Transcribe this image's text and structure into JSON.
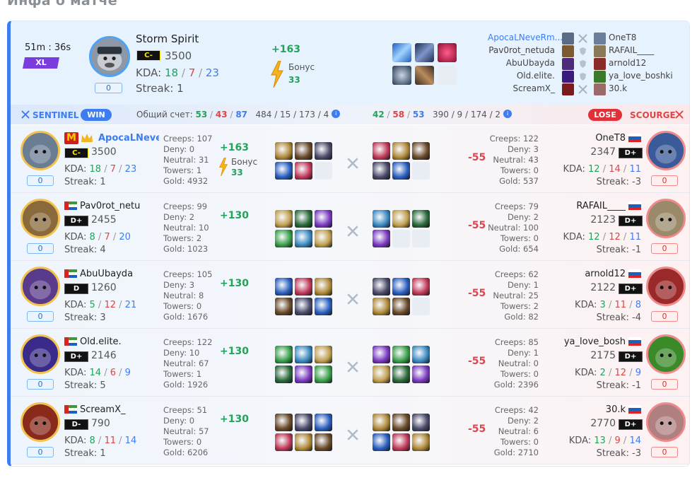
{
  "page_title": "Инфа о матче",
  "summary": {
    "duration": "51m : 36s",
    "mode_badge": "XL",
    "hero_name": "Storm Spirit",
    "rank": "C-",
    "mmr": "3500",
    "kda_label": "KDA:",
    "kills": "18",
    "deaths": "7",
    "assists": "23",
    "streak": "Streak: 1",
    "zero": "0",
    "gain": "+163",
    "bonus_label": "Бонус",
    "bonus_value": "33",
    "sentinel_players": [
      "ApocaLNeveRm...",
      "Pav0rot_netuda",
      "AbuUbayda",
      "Old.elite.",
      "ScreamX_"
    ],
    "scourge_players": [
      "OneT8",
      "RAFAIL____",
      "arnold12",
      "ya_love_boshki",
      "30.k"
    ]
  },
  "teambar": {
    "sentinel": "SENTINEL",
    "win": "WIN",
    "score_label": "Общий счет:",
    "s_k": "53",
    "s_d": "43",
    "s_a": "87",
    "s_rest": "484 / 15 / 173 / 4",
    "c_k": "42",
    "c_d": "58",
    "c_a": "53",
    "c_rest": "390 / 9 / 174 / 2",
    "lose": "LOSE",
    "scourge": "SCOURGE"
  },
  "rows": [
    {
      "left": {
        "name": "ApocaLNeveR",
        "rank": "C-",
        "mmr": "3500",
        "k": "18",
        "d": "7",
        "a": "23",
        "streak": "Streak: 1",
        "creeps": "Creeps: 107",
        "deny": "Deny: 0",
        "neutral": "Neutral: 31",
        "towers": "Towers: 1",
        "gold": "Gold: 4932"
      },
      "gain": "+163",
      "bonus_label": "Бонус",
      "bonus": "33",
      "loss": "-55",
      "right": {
        "name": "OneT8",
        "rank": "D+",
        "mmr": "2347",
        "k": "12",
        "d": "14",
        "a": "11",
        "streak": "Streak: -3",
        "creeps": "Creeps: 122",
        "deny": "Deny: 3",
        "neutral": "Neutral: 43",
        "towers": "Towers: 0",
        "gold": "Gold: 537"
      }
    },
    {
      "left": {
        "name": "Pav0rot_netu",
        "rank": "D+",
        "mmr": "2455",
        "k": "8",
        "d": "7",
        "a": "20",
        "streak": "Streak: 4",
        "creeps": "Creeps: 99",
        "deny": "Deny: 2",
        "neutral": "Neutral: 10",
        "towers": "Towers: 2",
        "gold": "Gold: 1023"
      },
      "gain": "+130",
      "loss": "-55",
      "right": {
        "name": "RAFAIL____",
        "rank": "D+",
        "mmr": "2123",
        "k": "12",
        "d": "12",
        "a": "11",
        "streak": "Streak: -1",
        "creeps": "Creeps: 79",
        "deny": "Deny: 2",
        "neutral": "Neutral: 100",
        "towers": "Towers: 0",
        "gold": "Gold: 654"
      }
    },
    {
      "left": {
        "name": "AbuUbayda",
        "rank": "D",
        "mmr": "1260",
        "k": "5",
        "d": "12",
        "a": "21",
        "streak": "Streak: 3",
        "creeps": "Creeps: 105",
        "deny": "Deny: 3",
        "neutral": "Neutral: 8",
        "towers": "Towers: 0",
        "gold": "Gold: 1676"
      },
      "gain": "+130",
      "loss": "-55",
      "right": {
        "name": "arnold12",
        "rank": "D+",
        "mmr": "2122",
        "k": "3",
        "d": "11",
        "a": "8",
        "streak": "Streak: -4",
        "creeps": "Creeps: 62",
        "deny": "Deny: 1",
        "neutral": "Neutral: 25",
        "towers": "Towers: 2",
        "gold": "Gold: 82"
      }
    },
    {
      "left": {
        "name": "Old.elite.",
        "rank": "D+",
        "mmr": "2146",
        "k": "14",
        "d": "6",
        "a": "9",
        "streak": "Streak: 5",
        "creeps": "Creeps: 122",
        "deny": "Deny: 10",
        "neutral": "Neutral: 67",
        "towers": "Towers: 1",
        "gold": "Gold: 1926"
      },
      "gain": "+130",
      "loss": "-55",
      "right": {
        "name": "ya_love_bosh",
        "rank": "D+",
        "mmr": "2175",
        "k": "2",
        "d": "12",
        "a": "9",
        "streak": "Streak: -1",
        "creeps": "Creeps: 85",
        "deny": "Deny: 1",
        "neutral": "Neutral: 0",
        "towers": "Towers: 0",
        "gold": "Gold: 2396"
      }
    },
    {
      "left": {
        "name": "ScreamX_",
        "rank": "D-",
        "mmr": "790",
        "k": "8",
        "d": "11",
        "a": "14",
        "streak": "Streak: 1",
        "creeps": "Creeps: 51",
        "deny": "Deny: 0",
        "neutral": "Neutral: 57",
        "towers": "Towers: 0",
        "gold": "Gold: 6206"
      },
      "gain": "+130",
      "loss": "-55",
      "right": {
        "name": "30.k",
        "rank": "D+",
        "mmr": "2770",
        "k": "13",
        "d": "9",
        "a": "14",
        "streak": "Streak: -3",
        "creeps": "Creeps: 42",
        "deny": "Deny: 2",
        "neutral": "Neutral: 6",
        "towers": "Towers: 0",
        "gold": "Gold: 2710"
      }
    }
  ],
  "kda_label": "KDA:",
  "zero": "0",
  "colors": {
    "accent": "#3d7df1",
    "win": "#22a35a",
    "lose": "#e04444",
    "xl": "#7c3bde"
  }
}
